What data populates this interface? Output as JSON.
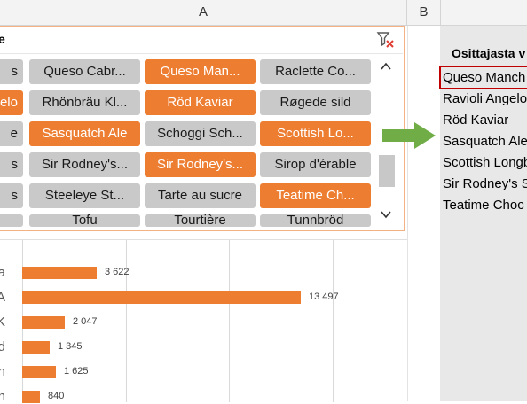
{
  "columns": {
    "a": "A",
    "b": "B"
  },
  "slicer": {
    "title": "e",
    "items": [
      {
        "label": "s",
        "selected": false
      },
      {
        "label": "Queso Cabr...",
        "selected": false
      },
      {
        "label": "Queso Man...",
        "selected": true
      },
      {
        "label": "Raclette Co...",
        "selected": false
      },
      {
        "label": "elo",
        "selected": true
      },
      {
        "label": "Rhönbräu Kl...",
        "selected": false
      },
      {
        "label": "Röd Kaviar",
        "selected": true
      },
      {
        "label": "Røgede sild",
        "selected": false
      },
      {
        "label": "e",
        "selected": false
      },
      {
        "label": "Sasquatch Ale",
        "selected": true
      },
      {
        "label": "Schoggi Sch...",
        "selected": false
      },
      {
        "label": "Scottish Lo...",
        "selected": true
      },
      {
        "label": "s",
        "selected": false
      },
      {
        "label": "Sir Rodney's...",
        "selected": false
      },
      {
        "label": "Sir Rodney's...",
        "selected": true
      },
      {
        "label": "Sirop d'érable",
        "selected": false
      },
      {
        "label": "s",
        "selected": false
      },
      {
        "label": "Steeleye St...",
        "selected": false
      },
      {
        "label": "Tarte au sucre",
        "selected": false
      },
      {
        "label": "Teatime Ch...",
        "selected": true
      },
      {
        "label": "",
        "selected": false
      },
      {
        "label": "Tofu",
        "selected": false
      },
      {
        "label": "Tourtière",
        "selected": false
      },
      {
        "label": "Tunnbröd",
        "selected": false
      }
    ]
  },
  "chart_data": {
    "type": "bar",
    "orientation": "horizontal",
    "categories": [
      "a",
      "A",
      "K",
      "d",
      "n",
      "n"
    ],
    "values": [
      3622,
      13497,
      2047,
      1345,
      1625,
      840
    ],
    "value_labels": [
      "3 622",
      "13 497",
      "2 047",
      "1 345",
      "1 625",
      "840"
    ],
    "xlim": [
      0,
      15000
    ],
    "grid": true,
    "color": "#ed7d31"
  },
  "helper_list": {
    "title": "Osittajasta v",
    "items": [
      "Queso Manch",
      "Ravioli Angelo",
      "Röd Kaviar",
      "Sasquatch Ale",
      "Scottish Longb",
      "Sir Rodney's S",
      "Teatime Choc"
    ]
  },
  "colors": {
    "selected": "#ed7d31",
    "unselected": "#c9c9c9",
    "arrow": "#70ad47",
    "highlight_border": "#c00000",
    "slicer_border": "#f4b184"
  },
  "icons": {
    "clear_filter": "clear-filter-icon",
    "scroll_up": "chevron-up-icon",
    "scroll_down": "chevron-down-icon",
    "arrow": "right-arrow-icon"
  }
}
